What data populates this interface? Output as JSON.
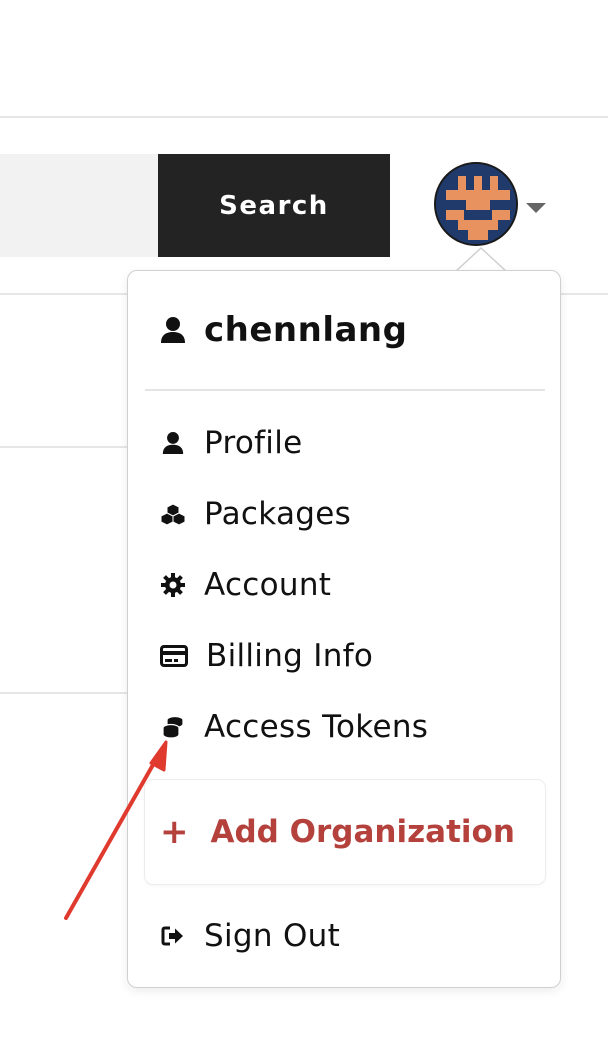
{
  "header": {
    "search": {
      "placeholder": "",
      "button_label": "Search"
    }
  },
  "account_menu": {
    "username": "chennlang",
    "items": [
      {
        "label": "Profile",
        "icon": "user-icon"
      },
      {
        "label": "Packages",
        "icon": "cubes-icon"
      },
      {
        "label": "Account",
        "icon": "gear-icon"
      },
      {
        "label": "Billing Info",
        "icon": "credit-card-icon"
      },
      {
        "label": "Access Tokens",
        "icon": "coins-icon"
      }
    ],
    "add_org_label": "Add Organization",
    "add_org_icon": "plus-icon",
    "sign_out_label": "Sign Out",
    "sign_out_icon": "sign-out-icon"
  },
  "colors": {
    "search_button_bg": "#232323",
    "add_org_text": "#b5413c",
    "annotation_arrow": "#e03a2f",
    "avatar_bg": "#1f3a6b",
    "avatar_fg": "#e8935f"
  }
}
